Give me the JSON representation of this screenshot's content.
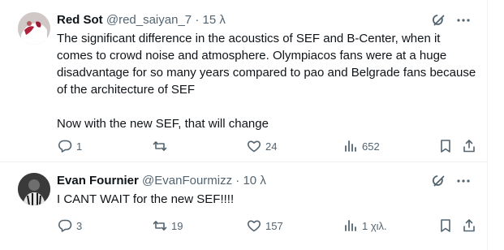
{
  "tweets": [
    {
      "display_name": "Red Sot",
      "handle": "@red_saiyan_7",
      "separator": "·",
      "time": "15 λ",
      "paragraphs": [
        "The significant difference in the acoustics of SEF and B-Center, when it comes to crowd noise and atmosphere. Olympiacos fans were at a huge disadvantage for so many years compared to pao and Belgrade fans because of the architecture of SEF",
        "Now with the new SEF, that will change"
      ],
      "replies": "1",
      "retweets": "",
      "likes": "24",
      "views": "652"
    },
    {
      "display_name": "Evan Fournier",
      "handle": "@EvanFourmizz",
      "separator": "·",
      "time": "10 λ",
      "paragraphs": [
        "I CANT WAIT for the new SEF!!!!"
      ],
      "replies": "3",
      "retweets": "19",
      "likes": "157",
      "views": "1 χιλ."
    }
  ],
  "icons": {
    "grok": "grok-icon",
    "more": "more-icon",
    "reply": "reply-icon",
    "retweet": "retweet-icon",
    "like": "heart-icon",
    "views": "views-icon",
    "bookmark": "bookmark-icon",
    "share": "share-icon"
  },
  "colors": {
    "text": "#0f1419",
    "secondary": "#536471",
    "divider": "#eff3f4"
  }
}
